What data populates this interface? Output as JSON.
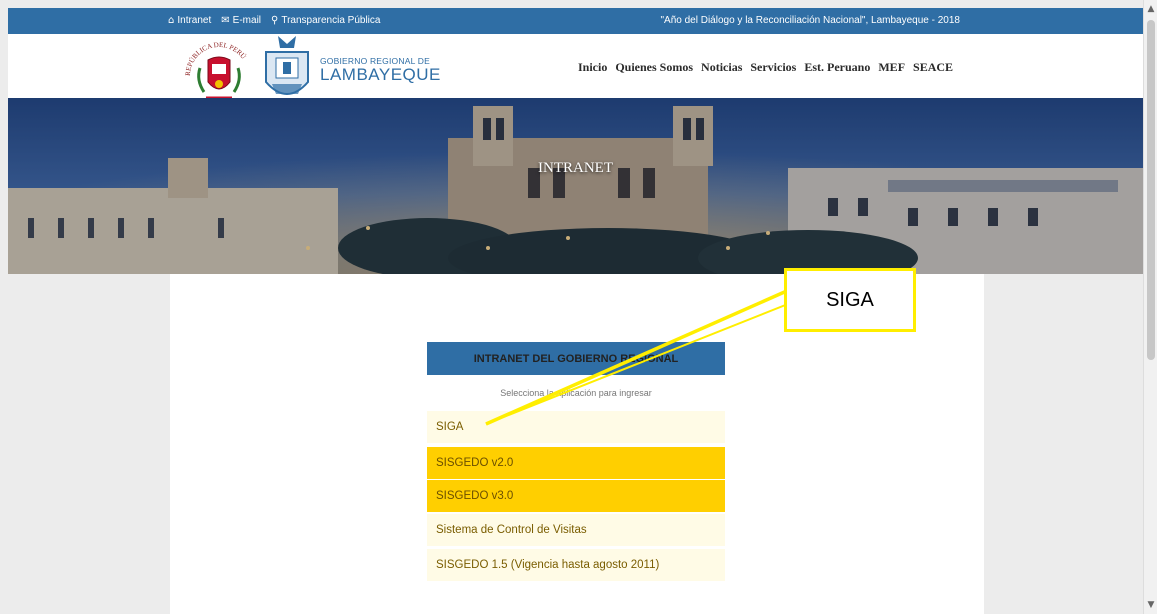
{
  "topbar": {
    "links": [
      {
        "icon": "home-icon",
        "glyph": "🏠",
        "label": "Intranet"
      },
      {
        "icon": "mail-icon",
        "glyph": "✉",
        "label": "E-mail"
      },
      {
        "icon": "search-icon",
        "glyph": "🔍",
        "label": "Transparencia Pública"
      }
    ],
    "motto": "\"Año del Diálogo y la Reconciliación Nacional\", Lambayeque - 2018"
  },
  "header": {
    "brand_small": "GOBIERNO REGIONAL DE",
    "brand_big": "LAMBAYEQUE",
    "seal_text": "REPÚBLICA DEL PERÚ",
    "nav": [
      "Inicio",
      "Quienes Somos",
      "Noticias",
      "Servicios",
      "Est. Peruano",
      "MEF",
      "SEACE"
    ]
  },
  "hero": {
    "title": "INTRANET"
  },
  "intranet": {
    "heading": "INTRANET DEL GOBIERNO REGIONAL",
    "subtitle": "Selecciona la aplicación para ingresar",
    "apps": [
      {
        "label": "SIGA",
        "highlight": false
      },
      {
        "label": "SISGEDO v2.0",
        "highlight": true
      },
      {
        "label": "SISGEDO v3.0",
        "highlight": true
      },
      {
        "label": "Sistema de Control de Visitas",
        "highlight": false
      },
      {
        "label": "SISGEDO 1.5 (Vigencia hasta agosto 2011)",
        "highlight": false
      }
    ]
  },
  "annotation": {
    "label": "SIGA",
    "color": "#ffee00"
  },
  "colors": {
    "brand_blue": "#2f6ea5",
    "gold": "#ffcf00",
    "cream": "#fffbe6"
  }
}
